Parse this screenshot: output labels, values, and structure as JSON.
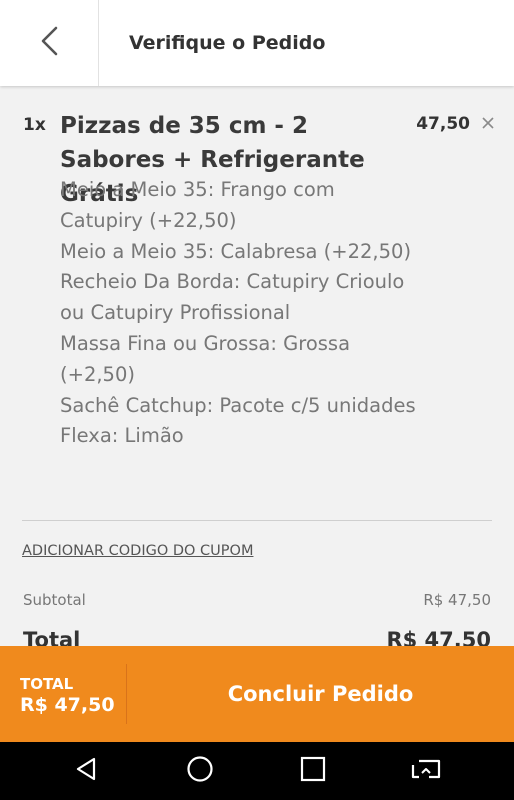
{
  "header": {
    "title": "Verifique o Pedido",
    "back_icon": "chevron-left-icon"
  },
  "item": {
    "quantity": "1x",
    "name": "Pizzas de 35 cm - 2 Sabores + Refrigerante Grátis",
    "price": "47,50",
    "remove_icon": "close-icon",
    "options": [
      "Meio a Meio 35: Frango com Catupiry (+22,50)",
      "Meio a Meio 35: Calabresa (+22,50)",
      "Recheio Da Borda: Catupiry Crioulo ou Catupiry Profissional",
      "Massa Fina ou Grossa: Grossa (+2,50)",
      "Sachê Catchup: Pacote c/5 unidades",
      "Flexa: Limão"
    ]
  },
  "coupon": {
    "label": "ADICIONAR CODIGO DO CUPOM"
  },
  "summary": {
    "subtotal_label": "Subtotal",
    "subtotal_value": "R$ 47,50",
    "total_label": "Total",
    "total_value": "R$ 47,50"
  },
  "footer": {
    "total_label": "TOTAL",
    "total_value": "R$ 47,50",
    "confirm_label": "Concluir Pedido"
  },
  "colors": {
    "accent": "#f08a1d",
    "header_bg": "#ffffff",
    "page_bg": "#f2f2f2",
    "navbar_bg": "#000000"
  },
  "navbar": {
    "icons": [
      "back-triangle-icon",
      "home-circle-icon",
      "recents-square-icon",
      "screen-cast-icon"
    ]
  }
}
